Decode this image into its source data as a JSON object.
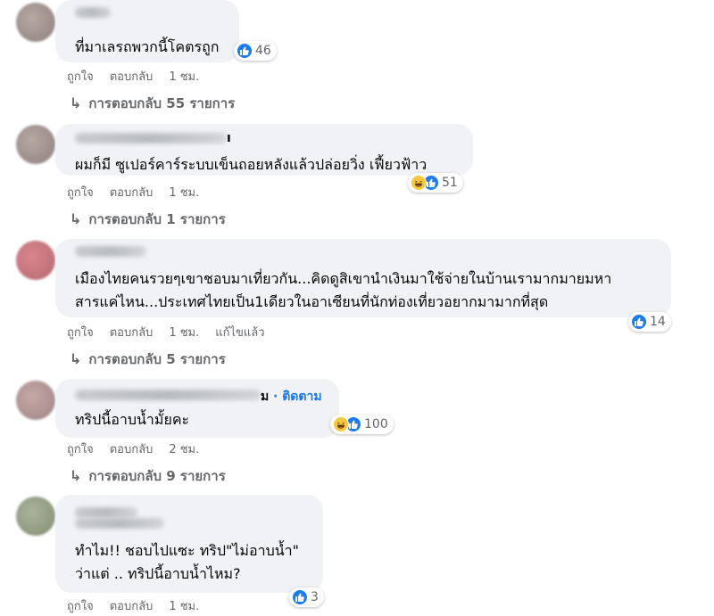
{
  "comments": [
    {
      "text_lines": [
        "ที่มาเลรถพวกนี้โคตรถูก"
      ],
      "reactions": {
        "types": [
          "like"
        ],
        "count": "46"
      },
      "meta": {
        "like": "ถูกใจ",
        "reply": "ตอบกลับ",
        "time": "1 ชม."
      },
      "replies": "การตอบกลับ 55 รายการ"
    },
    {
      "name_end": "ı",
      "text_lines": [
        "ผมก็มี ซูเปอร์คาร์ระบบเข็นถอยหลังแล้วปล่อยวิ่ง เฟี้ยวฟ้าว"
      ],
      "reactions": {
        "types": [
          "haha",
          "like"
        ],
        "count": "51"
      },
      "meta": {
        "like": "ถูกใจ",
        "reply": "ตอบกลับ",
        "time": "1 ชม."
      },
      "replies": "การตอบกลับ 1 รายการ"
    },
    {
      "text_lines": [
        "เมืองไทยคนรวยๆเขาชอบมาเที่ยวกัน...คิดดูสิเขานำเงินมาใช้จ่ายในบ้านเรามากมายมหา",
        "สารแค่ไหน...ประเทศไทยเป็น1เดียวในอาเซียนที่นักท่องเที่ยวอยากมามากที่สุด"
      ],
      "reactions": {
        "types": [
          "like"
        ],
        "count": "14"
      },
      "meta": {
        "like": "ถูกใจ",
        "reply": "ตอบกลับ",
        "time": "1 ชม.",
        "edited": "แก้ไขแล้ว"
      },
      "replies": "การตอบกลับ 5 รายการ"
    },
    {
      "name_end": "ม",
      "follow": "· ติดตาม",
      "text_lines": [
        "ทริปนี้อาบน้ำมั้ยคะ"
      ],
      "reactions": {
        "types": [
          "haha",
          "like"
        ],
        "count": "100"
      },
      "meta": {
        "like": "ถูกใจ",
        "reply": "ตอบกลับ",
        "time": "2 ชม."
      },
      "replies": "การตอบกลับ 9 รายการ"
    },
    {
      "text_lines": [
        "ทำไม!! ชอบไปแซะ ทริป\"ไม่อาบน้ำ\"",
        "ว่าแต่ .. ทริปนี้อาบน้ำไหม?"
      ],
      "reactions": {
        "types": [
          "like"
        ],
        "count": "3"
      },
      "meta": {
        "like": "ถูกใจ",
        "reply": "ตอบกลับ",
        "time": "1 ชม."
      }
    }
  ],
  "colors": {
    "like": "#1a7bf2",
    "haha": "#f7c93a",
    "bubble": "#f0f2f5",
    "meta": "#65676b",
    "follow": "#1877f2"
  }
}
